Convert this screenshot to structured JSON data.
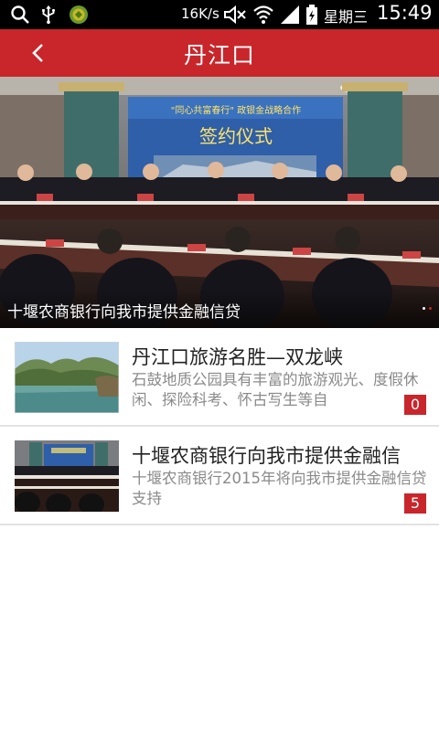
{
  "status_bar": {
    "net_speed": "16K/s",
    "weekday": "星期三",
    "time": "15:49",
    "icons": [
      "search-icon",
      "usb-icon",
      "app-notification-icon",
      "mute-icon",
      "wifi-icon",
      "signal-icon",
      "battery-icon"
    ]
  },
  "header": {
    "title": "丹江口",
    "back_icon": "chevron-left-icon",
    "background_color": "#c8262b"
  },
  "banner": {
    "caption": "十堰农商银行向我市提供金融信贷",
    "dot_count": 2,
    "active_dot": 0,
    "image_backdrop_text": "签约仪式"
  },
  "news": [
    {
      "title": "丹江口旅游名胜—双龙峡",
      "summary": "石鼓地质公园具有丰富的旅游观光、度假休闲、探险科考、怀古写生等自",
      "comments": "0",
      "thumb": "landscape-photo"
    },
    {
      "title": "十堰农商银行向我市提供金融信",
      "summary": "十堰农商银行2015年将向我市提供金融信贷支持",
      "comments": "5",
      "thumb": "meeting-photo"
    }
  ]
}
